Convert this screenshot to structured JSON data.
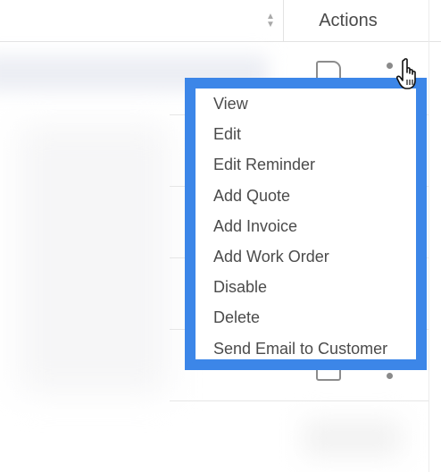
{
  "table": {
    "actions_header": "Actions",
    "sort_icon": "sort-up-down-icon"
  },
  "row_icons": {
    "edit": "document-icon",
    "more": "kebab-menu-icon"
  },
  "menu": {
    "items": [
      {
        "label": "View"
      },
      {
        "label": "Edit"
      },
      {
        "label": "Edit Reminder"
      },
      {
        "label": "Add Quote"
      },
      {
        "label": "Add Invoice"
      },
      {
        "label": "Add Work Order"
      },
      {
        "label": "Disable"
      },
      {
        "label": "Delete"
      },
      {
        "label": "Send Email to Customer"
      }
    ],
    "highlight_color": "#3c86e8"
  },
  "cursor": "hand-pointer-icon"
}
